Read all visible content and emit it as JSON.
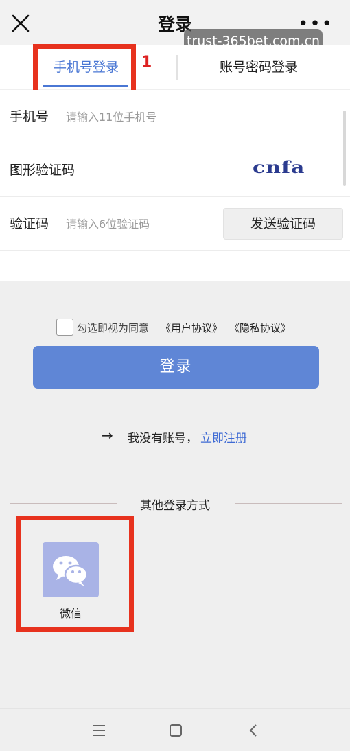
{
  "header": {
    "title": "登录",
    "close_icon": "close-icon",
    "more_icon": "more-icon",
    "more_glyph": "•••"
  },
  "watermark": "trust-365bet.com.cn",
  "tabs": [
    {
      "label": "手机号登录",
      "active": true
    },
    {
      "label": "账号密码登录",
      "active": false
    }
  ],
  "annotation": {
    "step_number": "1",
    "highlight_color": "#e7321e"
  },
  "form": {
    "phone": {
      "label": "手机号",
      "placeholder": "请输入11位手机号",
      "value": ""
    },
    "image_captcha": {
      "label": "图形验证码",
      "captcha_text": "cnfa"
    },
    "sms_code": {
      "label": "验证码",
      "placeholder": "请输入6位验证码",
      "value": "",
      "send_button": "发送验证码"
    }
  },
  "agreement": {
    "checked": false,
    "text": "勾选即视为同意",
    "user_agreement": "《用户协议》",
    "privacy_agreement": "《隐私协议》"
  },
  "login_button": "登录",
  "register": {
    "arrow": "→",
    "text": "我没有账号，",
    "link": "立即注册"
  },
  "other_login": {
    "title": "其他登录方式",
    "methods": [
      {
        "label": "微信",
        "icon": "wechat-icon"
      }
    ]
  },
  "colors": {
    "accent": "#5f86d6",
    "active_tab": "#4a77d4",
    "link": "#3e6ad4",
    "wechat_tile": "#a9b3e6"
  },
  "navbar": {
    "icons": [
      "menu-icon",
      "home-icon",
      "back-icon"
    ]
  }
}
